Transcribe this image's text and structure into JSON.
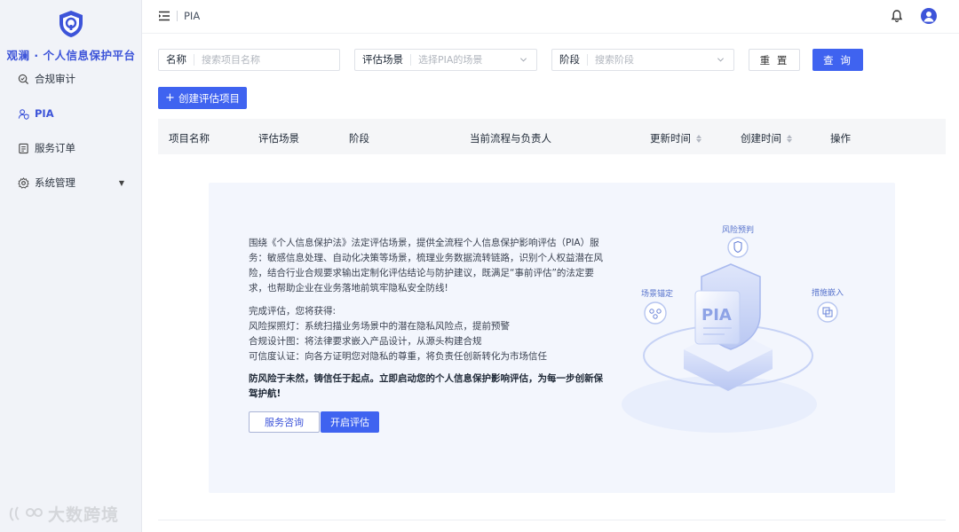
{
  "app": {
    "title": "观澜 · 个人信息保护平台"
  },
  "sidebar": {
    "items": [
      {
        "label": "合规审计",
        "icon": "audit-icon"
      },
      {
        "label": "PIA",
        "icon": "user-shield-icon",
        "active": true
      },
      {
        "label": "服务订单",
        "icon": "order-icon"
      },
      {
        "label": "系统管理",
        "icon": "gear-icon",
        "expandable": true
      }
    ]
  },
  "header": {
    "breadcrumb": "PIA"
  },
  "filters": {
    "name_label": "名称",
    "name_placeholder": "搜索项目名称",
    "scene_label": "评估场景",
    "scene_placeholder": "选择PIA的场景",
    "stage_label": "阶段",
    "stage_placeholder": "搜索阶段",
    "reset_label": "重 置",
    "query_label": "查 询"
  },
  "create_button": {
    "plus": "+",
    "label": "创建评估项目"
  },
  "table": {
    "columns": [
      "项目名称",
      "评估场景",
      "阶段",
      "当前流程与负责人",
      "更新时间",
      "创建时间",
      "操作"
    ]
  },
  "intro": {
    "p1": "围绕《个人信息保护法》法定评估场景，提供全流程个人信息保护影响评估（PIA）服务：敏感信息处理、自动化决策等场景，梳理业务数据流转链路，识别个人权益潜在风险，结合行业合规要求输出定制化评估结论与防护建议，既满足“事前评估”的法定要求，也帮助企业在业务落地前筑牢隐私安全防线!",
    "p2_title": "完成评估，您将获得:",
    "benefits": [
      "风险探照灯：系统扫描业务场景中的潜在隐私风险点，提前预警",
      "合规设计图：将法律要求嵌入产品设计，从源头构建合规",
      "可信度认证：向各方证明您对隐私的尊重，将负责任创新转化为市场信任"
    ],
    "slogan": "防风险于未然，铸信任于起点。立即启动您的个人信息保护影响评估，为每一步创新保驾护航!",
    "consult_button": "服务咨询",
    "start_button": "开启评估"
  },
  "illustration": {
    "badge_text": "PIA",
    "tags": [
      "风险预判",
      "场景锚定",
      "措施嵌入"
    ]
  },
  "watermark": "大数跨境",
  "colors": {
    "primary": "#3f63f0",
    "brand_text": "#3d54d9",
    "sidebar_bg": "#f1f3f8",
    "panel_bg": "#f3f6fd"
  }
}
